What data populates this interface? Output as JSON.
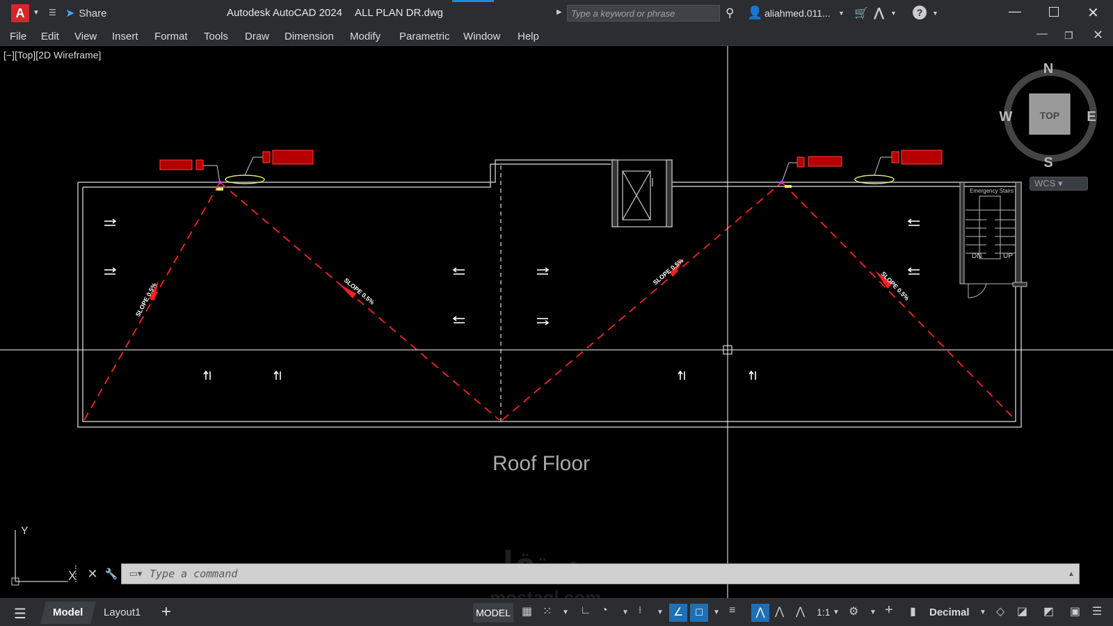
{
  "titlebar": {
    "app_logo": "A",
    "share_label": "Share",
    "app_title": "Autodesk AutoCAD 2024",
    "file_name": "ALL PLAN DR.dwg",
    "search_placeholder": "Type a keyword or phrase",
    "user_name": "aliahmed.011...",
    "help_label": "?"
  },
  "menu": {
    "items": [
      "File",
      "Edit",
      "View",
      "Insert",
      "Format",
      "Tools",
      "Draw",
      "Dimension",
      "Modify",
      "Parametric",
      "Window",
      "Help"
    ]
  },
  "viewport": {
    "label": "[−][Top][2D Wireframe]",
    "drawing_title": "Roof Floor",
    "slope_label": "SLOPE 0.5%",
    "stair_label": "Emergency Stairs",
    "stair_down": "DN",
    "stair_up": "UP",
    "accent_color": "#ff2020"
  },
  "viewcube": {
    "north": "N",
    "south": "S",
    "east": "E",
    "west": "W",
    "face": "TOP",
    "wcs_label": "WCS"
  },
  "ucs": {
    "x_label": "X",
    "y_label": "Y"
  },
  "command": {
    "placeholder": "Type a command"
  },
  "watermark": {
    "text": "مستقل",
    "sub": "mostaql.com"
  },
  "statusbar": {
    "tab_model": "Model",
    "tab_layout": "Layout1",
    "model_label": "MODEL",
    "scale": "1:1",
    "units": "Decimal"
  },
  "icons": {
    "share": "paper-plane-icon",
    "search": "search-icon",
    "user": "user-icon",
    "cart": "cart-icon",
    "help": "help-icon"
  }
}
